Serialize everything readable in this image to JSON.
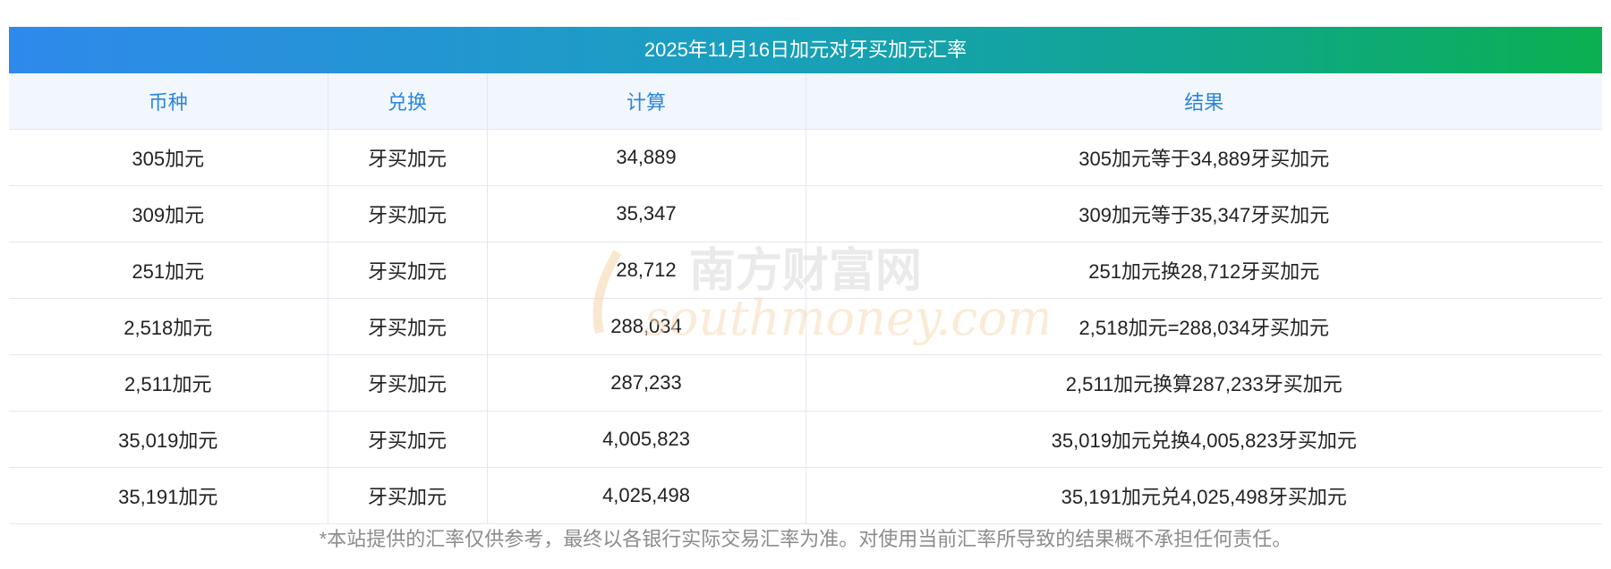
{
  "title": "2025年11月16日加元对牙买加元汇率",
  "columns": [
    "币种",
    "兑换",
    "计算",
    "结果"
  ],
  "rows": [
    {
      "currency": "305加元",
      "exchange": "牙买加元",
      "calc": "34,889",
      "result": "305加元等于34,889牙买加元"
    },
    {
      "currency": "309加元",
      "exchange": "牙买加元",
      "calc": "35,347",
      "result": "309加元等于35,347牙买加元"
    },
    {
      "currency": "251加元",
      "exchange": "牙买加元",
      "calc": "28,712",
      "result": "251加元换28,712牙买加元"
    },
    {
      "currency": "2,518加元",
      "exchange": "牙买加元",
      "calc": "288,034",
      "result": "2,518加元=288,034牙买加元"
    },
    {
      "currency": "2,511加元",
      "exchange": "牙买加元",
      "calc": "287,233",
      "result": "2,511加元换算287,233牙买加元"
    },
    {
      "currency": "35,019加元",
      "exchange": "牙买加元",
      "calc": "4,005,823",
      "result": "35,019加元兑换4,005,823牙买加元"
    },
    {
      "currency": "35,191加元",
      "exchange": "牙买加元",
      "calc": "4,025,498",
      "result": "35,191加元兑4,025,498牙买加元"
    }
  ],
  "footnote": "*本站提供的汇率仅供参考，最终以各银行实际交易汇率为准。对使用当前汇率所导致的结果概不承担任何责任。",
  "watermark": {
    "cn": "南方财富网",
    "en": "southmoney.com"
  },
  "colors": {
    "title_gradient_start": "#2f89ec",
    "title_gradient_end": "#0bb050",
    "header_bg": "#f2f7fe",
    "header_text": "#2b86dc",
    "border": "#e3e8ef",
    "footnote_text": "#8c8c8c"
  }
}
